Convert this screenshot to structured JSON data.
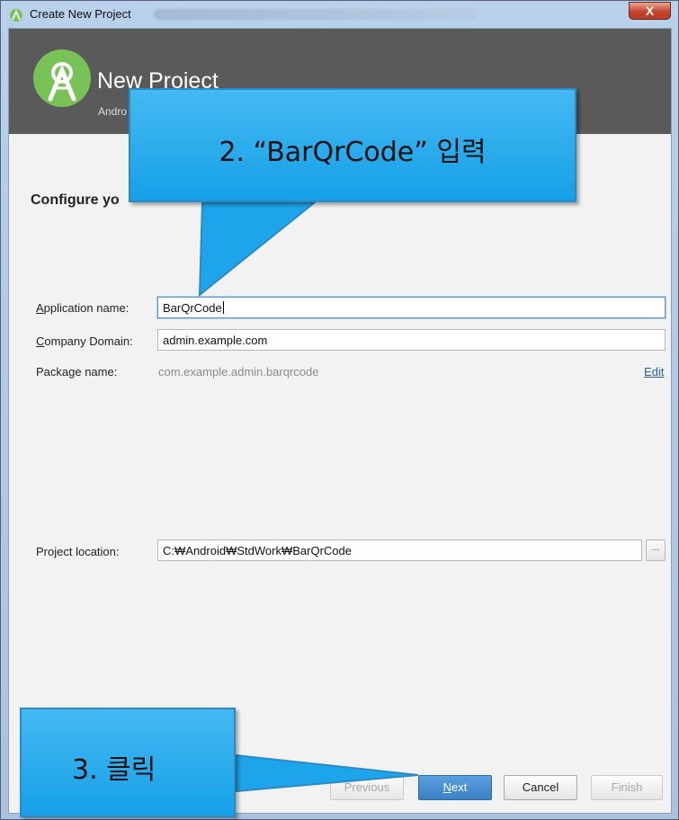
{
  "window": {
    "title": "Create New Project",
    "close_glyph": "X"
  },
  "header": {
    "title": "New Project",
    "subtitle": "Andro"
  },
  "configure": {
    "title": "Configure yo"
  },
  "form": {
    "app_name_label_ul": "A",
    "app_name_label_rest": "pplication name:",
    "app_name_value": "BarQrCode",
    "company_label_ul": "C",
    "company_label_rest": "ompany Domain:",
    "company_value": "admin.example.com",
    "package_label": "Package name:",
    "package_value": "com.example.admin.barqrcode",
    "edit_link": "Edit",
    "location_label": "Project location:",
    "location_value": "C:₩Android₩StdWork₩BarQrCode",
    "browse_label": "..."
  },
  "buttons": {
    "previous": "Previous",
    "next_ul": "N",
    "next_rest": "ext",
    "cancel": "Cancel",
    "finish": "Finish"
  },
  "annotations": {
    "callout_top": "2.  “BarQrCode” 입력",
    "callout_bottom": "3.  클릭"
  },
  "colors": {
    "callout_fill": "#29abec",
    "header_bg": "#5a5a5a",
    "primary_button": "#3b7fc6"
  }
}
